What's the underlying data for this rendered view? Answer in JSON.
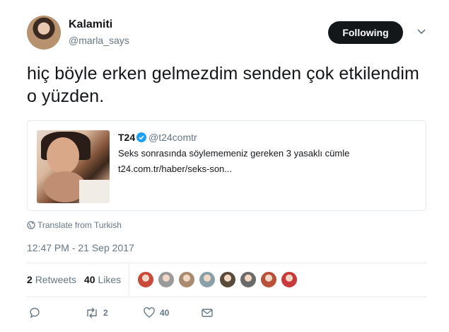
{
  "author": {
    "name": "Kalamiti",
    "handle": "@marla_says"
  },
  "follow_button": {
    "label": "Following"
  },
  "tweet": {
    "text": "hiç böyle erken gelmezdim senden çok etkilendim o yüzden."
  },
  "quoted_card": {
    "author": "T24",
    "handle": "@t24comtr",
    "title": "Seks sonrasında söylememeniz gereken 3 yasaklı cümle",
    "url": "t24.com.tr/haber/seks-son..."
  },
  "translate_label": "Translate from Turkish",
  "timestamp": "12:47 PM - 21 Sep 2017",
  "stats": {
    "retweets_count": "2",
    "retweets_label": "Retweets",
    "likes_count": "40",
    "likes_label": "Likes"
  },
  "liker_avatars": [
    "#c94a3a",
    "#9a9a9a",
    "#a88a70",
    "#8aa0a8",
    "#5a4a3a",
    "#6a6a6a",
    "#b8503a",
    "#c83a3a"
  ],
  "actions": {
    "reply_count": "",
    "retweet_count": "2",
    "like_count": "40"
  },
  "colors": {
    "text": "#14171a",
    "muted": "#657786",
    "verified": "#1da1f2",
    "button_bg": "#14171a"
  }
}
